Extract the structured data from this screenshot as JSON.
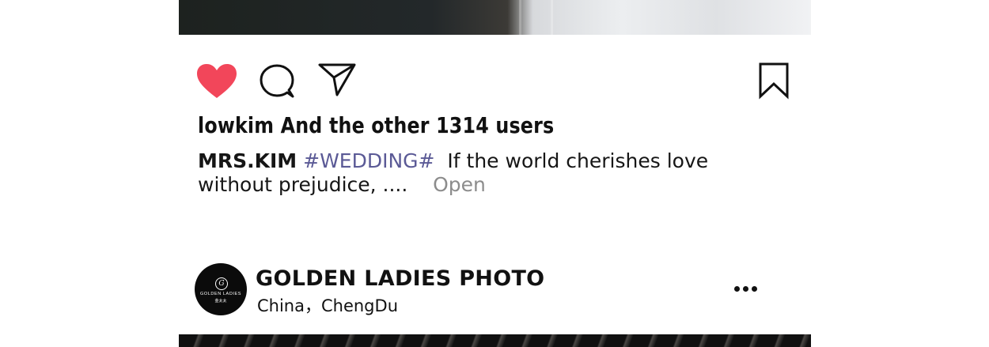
{
  "post": {
    "actions": {
      "like_icon": "heart-filled-icon",
      "comment_icon": "comment-bubble-icon",
      "share_icon": "paper-plane-icon",
      "save_icon": "bookmark-icon",
      "like_color": "#f2465a"
    },
    "likes_text": "lowkim And the other 1314 users",
    "caption": {
      "username": "MRS.KIM",
      "hashtag": "#WEDDING#",
      "text": "If the world cherishes love without prejudice, ....",
      "more_label": "Open",
      "hashtag_color": "#5b5a96"
    }
  },
  "next_post": {
    "avatar": {
      "monogram": "G",
      "brand_text": "GOLDEN LADIES",
      "brand_sub": "金太太"
    },
    "account_name": "GOLDEN LADIES PHOTO",
    "location": "China，ChengDu",
    "more_icon": "more-horizontal-icon"
  }
}
